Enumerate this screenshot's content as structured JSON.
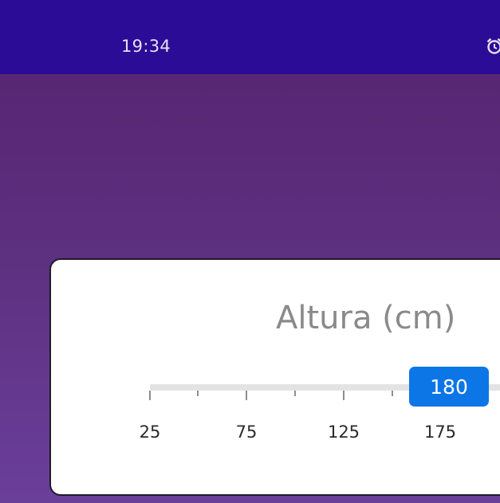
{
  "status_bar": {
    "time": "19:34",
    "icons": [
      "alarm-icon"
    ]
  },
  "slider": {
    "title": "Altura (cm)",
    "value": "180",
    "tick_labels": [
      "25",
      "75",
      "125",
      "175"
    ],
    "colors": {
      "thumb": "#0d76e6",
      "status_bar": "#2a0c96",
      "background": "#5c2e7d"
    }
  }
}
